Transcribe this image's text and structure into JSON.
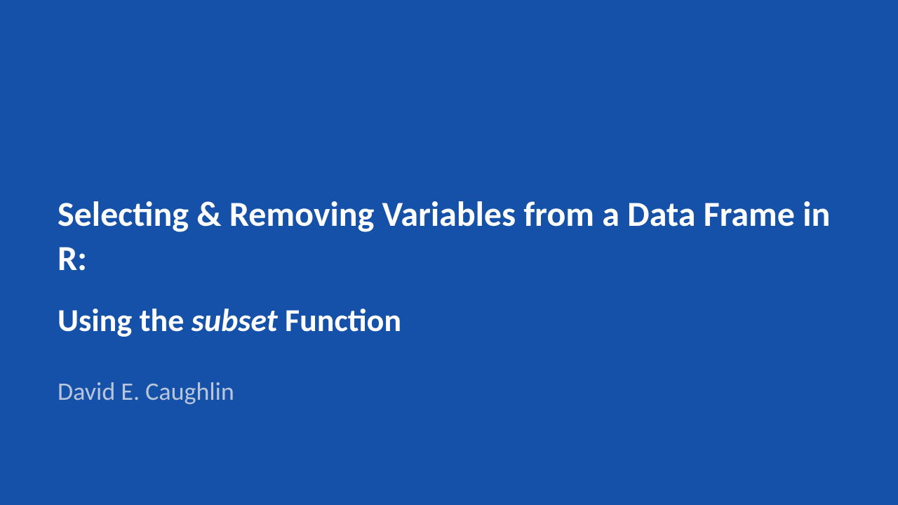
{
  "slide": {
    "title": "Selecting & Removing Variables from a Data Frame in R:",
    "subtitle_prefix": "Using the ",
    "subtitle_italic": "subset",
    "subtitle_suffix": " Function",
    "author": "David E. Caughlin"
  }
}
